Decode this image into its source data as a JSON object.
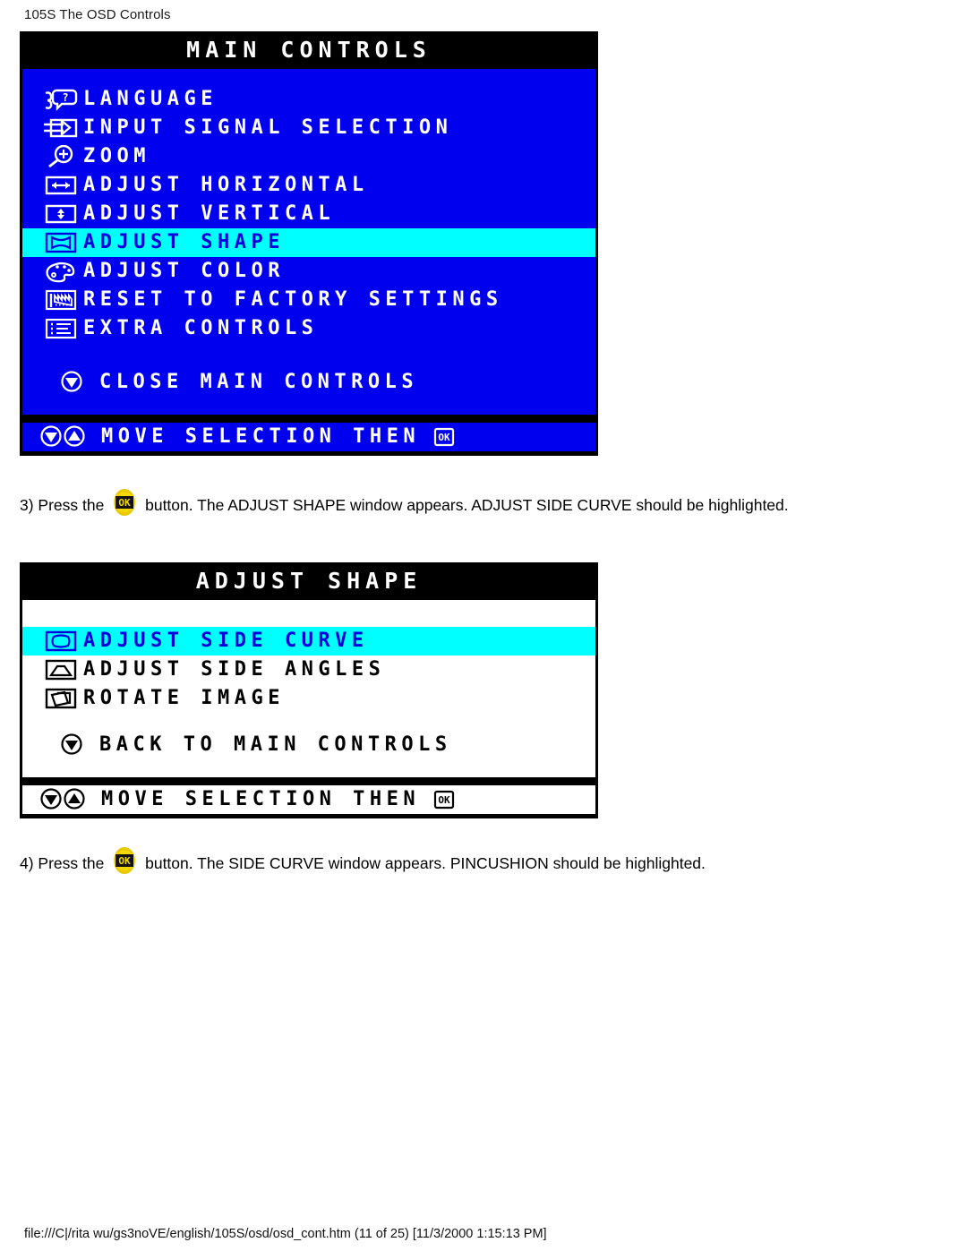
{
  "page": {
    "header": "105S The OSD Controls",
    "footer": "file:///C|/rita wu/gs3noVE/english/105S/osd/osd_cont.htm (11 of 25) [11/3/2000 1:15:13 PM]",
    "background": "#ffffff"
  },
  "colors": {
    "osd_blue": "#0000ee",
    "osd_highlight_cyan": "#00ffff",
    "osd_highlight_text": "#0000dd",
    "osd_title_bar": "#000000",
    "osd_white": "#ffffff",
    "ok_button_yellow": "#e8c800"
  },
  "main_controls": {
    "title": "MAIN CONTROLS",
    "theme": "blue",
    "items": [
      {
        "label": "LANGUAGE",
        "icon": "language-speech-bubble-icon",
        "highlighted": false
      },
      {
        "label": "INPUT SIGNAL SELECTION",
        "icon": "input-signal-arrow-icon",
        "highlighted": false
      },
      {
        "label": "ZOOM",
        "icon": "zoom-magnifier-plus-icon",
        "highlighted": false
      },
      {
        "label": "ADJUST HORIZONTAL",
        "icon": "horizontal-arrows-icon",
        "highlighted": false
      },
      {
        "label": "ADJUST VERTICAL",
        "icon": "vertical-arrows-icon",
        "highlighted": false
      },
      {
        "label": "ADJUST SHAPE",
        "icon": "adjust-shape-icon",
        "highlighted": true
      },
      {
        "label": "ADJUST COLOR",
        "icon": "color-palette-icon",
        "highlighted": false
      },
      {
        "label": "RESET TO FACTORY SETTINGS",
        "icon": "factory-reset-icon",
        "highlighted": false
      },
      {
        "label": "EXTRA CONTROLS",
        "icon": "extra-controls-list-icon",
        "highlighted": false
      }
    ],
    "close_item": {
      "label": "CLOSE MAIN CONTROLS",
      "icon": "down-arrow-circle-icon"
    },
    "footer_bar": {
      "label": "MOVE SELECTION THEN",
      "icons": [
        "down-arrow-circle-icon",
        "up-arrow-circle-icon",
        "ok-key-icon"
      ]
    }
  },
  "adjust_shape": {
    "title": "ADJUST SHAPE",
    "theme": "white",
    "items": [
      {
        "label": "ADJUST SIDE CURVE",
        "icon": "side-curve-icon",
        "highlighted": true
      },
      {
        "label": "ADJUST SIDE ANGLES",
        "icon": "side-angles-trapezoid-icon",
        "highlighted": false
      },
      {
        "label": "ROTATE IMAGE",
        "icon": "rotate-image-icon",
        "highlighted": false
      }
    ],
    "close_item": {
      "label": "BACK TO MAIN CONTROLS",
      "icon": "down-arrow-circle-icon"
    },
    "footer_bar": {
      "label": "MOVE SELECTION THEN",
      "icons": [
        "down-arrow-circle-icon",
        "up-arrow-circle-icon",
        "ok-key-icon"
      ]
    }
  },
  "steps": [
    {
      "number": "3)",
      "before": "3) Press the",
      "button_icon": "ok-button-icon",
      "after": "button. The ADJUST SHAPE window appears. ADJUST SIDE CURVE should be highlighted."
    },
    {
      "number": "4)",
      "before": "4) Press the",
      "button_icon": "ok-button-icon",
      "after": "button. The SIDE CURVE window appears. PINCUSHION should be highlighted."
    }
  ]
}
